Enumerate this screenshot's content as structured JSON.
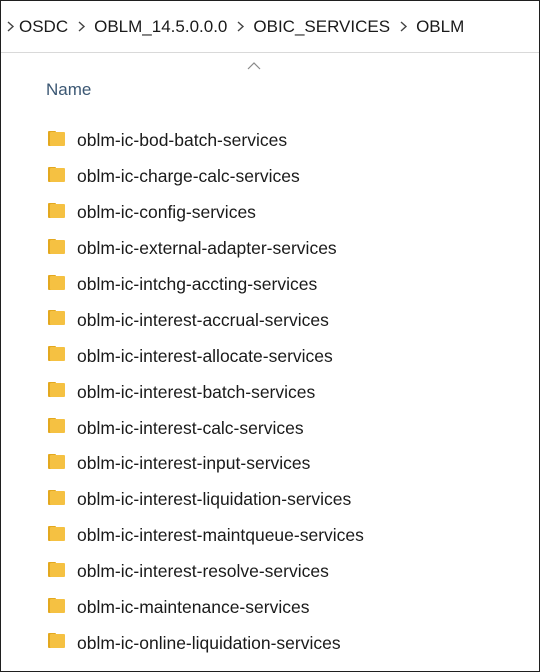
{
  "breadcrumb": {
    "items": [
      "OSDC",
      "OBLM_14.5.0.0.0",
      "OBIC_SERVICES",
      "OBLM"
    ]
  },
  "columns": {
    "name": "Name",
    "sort_direction": "ascending"
  },
  "files": [
    {
      "name": "oblm-ic-bod-batch-services",
      "icon": "folder-icon"
    },
    {
      "name": "oblm-ic-charge-calc-services",
      "icon": "folder-icon"
    },
    {
      "name": "oblm-ic-config-services",
      "icon": "folder-icon"
    },
    {
      "name": "oblm-ic-external-adapter-services",
      "icon": "folder-icon"
    },
    {
      "name": "oblm-ic-intchg-accting-services",
      "icon": "folder-icon"
    },
    {
      "name": "oblm-ic-interest-accrual-services",
      "icon": "folder-icon"
    },
    {
      "name": "oblm-ic-interest-allocate-services",
      "icon": "folder-icon"
    },
    {
      "name": "oblm-ic-interest-batch-services",
      "icon": "folder-icon"
    },
    {
      "name": "oblm-ic-interest-calc-services",
      "icon": "folder-icon"
    },
    {
      "name": "oblm-ic-interest-input-services",
      "icon": "folder-icon"
    },
    {
      "name": "oblm-ic-interest-liquidation-services",
      "icon": "folder-icon"
    },
    {
      "name": "oblm-ic-interest-maintqueue-services",
      "icon": "folder-icon"
    },
    {
      "name": "oblm-ic-interest-resolve-services",
      "icon": "folder-icon"
    },
    {
      "name": "oblm-ic-maintenance-services",
      "icon": "folder-icon"
    },
    {
      "name": "oblm-ic-online-liquidation-services",
      "icon": "folder-icon"
    }
  ],
  "colors": {
    "folder": "#f5c142",
    "folder_dark": "#e3a81f",
    "header_text": "#3b5773",
    "text": "#1a1a1a"
  }
}
